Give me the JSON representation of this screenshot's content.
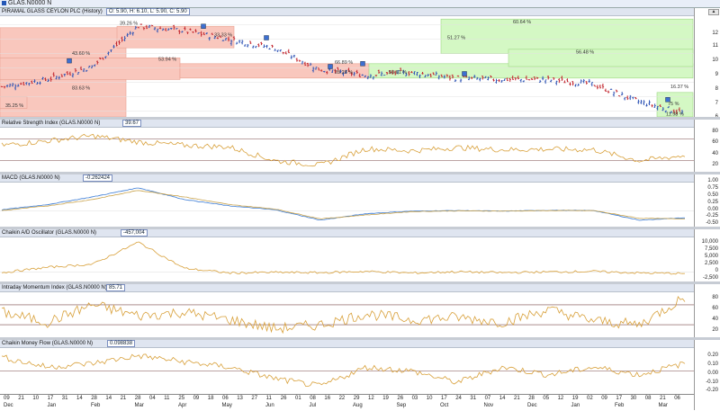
{
  "window": {
    "title": "GLAS.N0000 N"
  },
  "price_panel": {
    "name": "PIRAMAL GLASS CEYLON PLC (History)",
    "ohlc": "O: 5.90, H: 6.10, L: 5.90, C: 5.90",
    "y_ticks": [
      "12",
      "11",
      "10",
      "9",
      "8",
      "7",
      "6"
    ]
  },
  "panels": [
    {
      "key": "rsi",
      "name": "Relative Strength Index (GLAS.N0000 N)",
      "value": "39.67",
      "y_ticks": [
        "80",
        "60",
        "40",
        "20"
      ]
    },
    {
      "key": "macd",
      "name": "MACD (GLAS.N0000 N)",
      "value": "-0.262424",
      "y_ticks": [
        "1.00",
        "0.75",
        "0.50",
        "0.25",
        "0.00",
        "-0.25",
        "-0.50"
      ]
    },
    {
      "key": "ad",
      "name": "Chaikin A/D Oscillator (GLAS.N0000 N)",
      "value": "-457,004",
      "y_ticks": [
        "10,000",
        "7,500",
        "5,000",
        "2,500",
        "0",
        "-2,500"
      ]
    },
    {
      "key": "imi",
      "name": "Intraday Momentum Index (GLAS.N0000 N)",
      "value": "85.71",
      "y_ticks": [
        "80",
        "60",
        "40",
        "20"
      ]
    },
    {
      "key": "cmf",
      "name": "Chaikin Money Flow (GLAS.N0000 N)",
      "value": "0.098838",
      "y_ticks": [
        "0.20",
        "0.10",
        "0.00",
        "-0.10",
        "-0.20"
      ]
    }
  ],
  "x_axis": {
    "days": [
      "09",
      "21",
      "10",
      "17",
      "31",
      "14",
      "28",
      "14",
      "21",
      "28",
      "04",
      "11",
      "25",
      "09",
      "18",
      "06",
      "13",
      "27",
      "11",
      "26",
      "01",
      "08",
      "16",
      "22",
      "29",
      "12",
      "19",
      "26",
      "03",
      "10",
      "17",
      "24",
      "31",
      "07",
      "14",
      "21",
      "28",
      "05",
      "12",
      "19",
      "02",
      "09",
      "17",
      "30",
      "08",
      "21",
      "06"
    ],
    "months": [
      "Dec",
      "Jan",
      "Feb",
      "Mar",
      "Apr",
      "May",
      "Jun",
      "Jul",
      "Aug",
      "Sep",
      "Oct",
      "Nov",
      "Dec",
      "Jan",
      "Feb",
      "Mar"
    ]
  },
  "chart_data": [
    {
      "type": "candlestick",
      "title": "PIRAMAL GLASS CEYLON PLC (History)",
      "ylim": [
        5.6,
        12.6
      ],
      "x": [
        "Dec",
        "Jan",
        "Feb",
        "Mar",
        "Apr",
        "May",
        "Jun",
        "Jul",
        "Aug",
        "Sep",
        "Oct",
        "Nov",
        "Dec",
        "Jan",
        "Feb",
        "Mar"
      ],
      "close": [
        7.7,
        8.2,
        9.1,
        11.9,
        11.6,
        11.0,
        10.4,
        8.9,
        8.5,
        8.7,
        8.3,
        8.2,
        8.2,
        7.9,
        6.7,
        5.9
      ],
      "annotations": [
        "35.25 %",
        "83.63 %",
        "43.60 %",
        "39.26 %",
        "53.94 %",
        "33.33 %",
        "66.89 %",
        "28.28 %",
        "50.61 %",
        "51.27 %",
        "60.64 %",
        "56.48 %",
        "16.37 %",
        "75 %",
        "11.98 %"
      ]
    },
    {
      "type": "line",
      "title": "Relative Strength Index (GLAS.N0000 N)",
      "ylim": [
        10,
        90
      ],
      "reference": [
        30,
        70
      ],
      "x": [
        "Dec",
        "Jan",
        "Feb",
        "Mar",
        "Apr",
        "May",
        "Jun",
        "Jul",
        "Aug",
        "Sep",
        "Oct",
        "Nov",
        "Dec",
        "Jan",
        "Feb",
        "Mar"
      ],
      "values": [
        58,
        66,
        75,
        64,
        58,
        55,
        30,
        22,
        52,
        48,
        54,
        50,
        51,
        50,
        30,
        39.67
      ]
    },
    {
      "type": "line",
      "title": "MACD (GLAS.N0000 N)",
      "ylim": [
        -0.6,
        1.1
      ],
      "x": [
        "Dec",
        "Jan",
        "Feb",
        "Mar",
        "Apr",
        "May",
        "Jun",
        "Jul",
        "Aug",
        "Sep",
        "Oct",
        "Nov",
        "Dec",
        "Jan",
        "Feb",
        "Mar"
      ],
      "series": [
        {
          "values": [
            0.05,
            0.25,
            0.55,
            0.9,
            0.45,
            0.2,
            0.05,
            -0.35,
            -0.1,
            0.0,
            0.02,
            0.0,
            0.03,
            0.02,
            -0.35,
            -0.26
          ]
        },
        {
          "values": [
            0.02,
            0.2,
            0.45,
            0.8,
            0.55,
            0.25,
            0.08,
            -0.3,
            -0.15,
            -0.02,
            0.01,
            0.0,
            0.02,
            0.02,
            -0.28,
            -0.3
          ]
        }
      ]
    },
    {
      "type": "line",
      "title": "Chaikin A/D Oscillator (GLAS.N0000 N)",
      "ylim": [
        -3000,
        11000
      ],
      "x": [
        "Dec",
        "Jan",
        "Feb",
        "Mar",
        "Apr",
        "May",
        "Jun",
        "Jul",
        "Aug",
        "Sep",
        "Oct",
        "Nov",
        "Dec",
        "Jan",
        "Feb",
        "Mar"
      ],
      "values": [
        -200,
        1500,
        2500,
        9500,
        1200,
        -300,
        -100,
        -200,
        200,
        -300,
        100,
        -200,
        50,
        200,
        -300,
        -457
      ]
    },
    {
      "type": "line",
      "title": "Intraday Momentum Index (GLAS.N0000 N)",
      "ylim": [
        5,
        95
      ],
      "reference": [
        30,
        70
      ],
      "x": [
        "Dec",
        "Jan",
        "Feb",
        "Mar",
        "Apr",
        "May",
        "Jun",
        "Jul",
        "Aug",
        "Sep",
        "Oct",
        "Nov",
        "Dec",
        "Jan",
        "Feb",
        "Mar"
      ],
      "values": [
        55,
        35,
        70,
        48,
        55,
        40,
        22,
        30,
        52,
        40,
        45,
        35,
        60,
        38,
        30,
        85.71
      ]
    },
    {
      "type": "line",
      "title": "Chaikin Money Flow (GLAS.N0000 N)",
      "ylim": [
        -0.3,
        0.3
      ],
      "x": [
        "Dec",
        "Jan",
        "Feb",
        "Mar",
        "Apr",
        "May",
        "Jun",
        "Jul",
        "Aug",
        "Sep",
        "Oct",
        "Nov",
        "Dec",
        "Jan",
        "Feb",
        "Mar"
      ],
      "values": [
        0.18,
        0.05,
        0.1,
        0.2,
        0.12,
        0.05,
        -0.1,
        -0.2,
        0.05,
        0.0,
        -0.15,
        0.05,
        -0.05,
        0.05,
        -0.05,
        0.099
      ]
    }
  ],
  "colors": {
    "zone_red": "#f9c7bd",
    "zone_green": "#d4f8c4",
    "bar_up": "#2f54b5",
    "bar_down": "#c2262e",
    "indicator": "#d8a03a",
    "macd_fast": "#3a7bd5",
    "macd_slow": "#c9a24a",
    "ref_line": "#7a4a4a"
  }
}
